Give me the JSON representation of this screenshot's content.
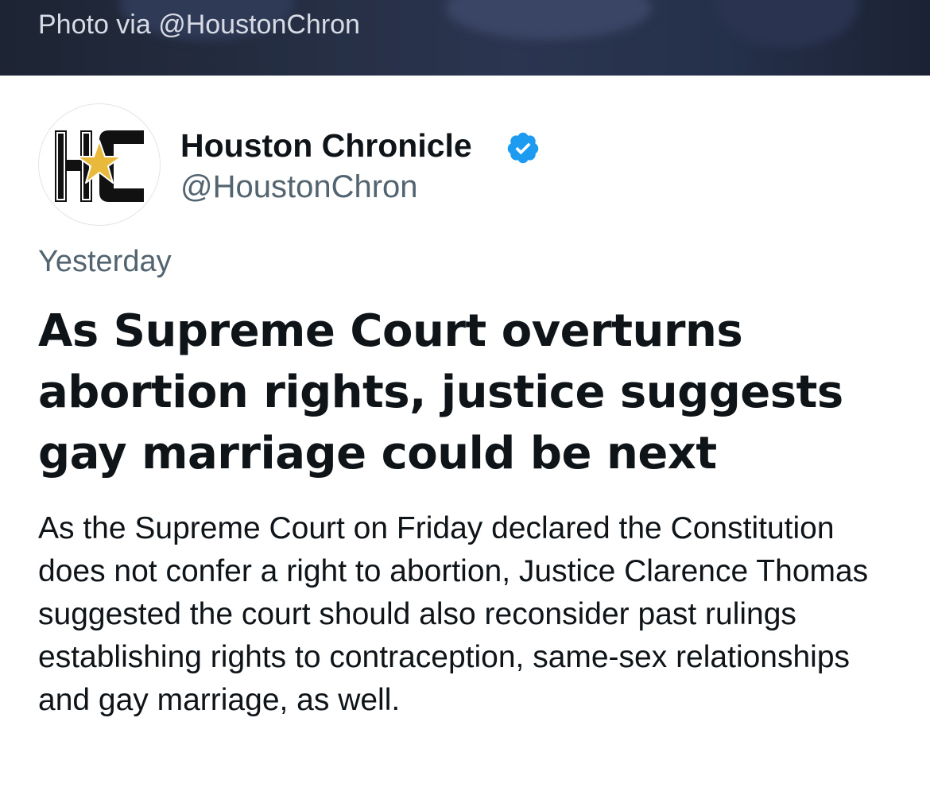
{
  "photo": {
    "credit": "Photo via @HoustonChron"
  },
  "author": {
    "name": "Houston Chronicle",
    "handle": "@HoustonChron",
    "verified": true,
    "verified_icon": "verified-badge-icon",
    "avatar_text": "HC"
  },
  "article": {
    "timestamp": "Yesterday",
    "headline": "As Supreme Court overturns abortion rights, justice suggests gay marriage could be next",
    "summary": "As the Supreme Court on Friday declared the Constitution does not confer a right to abortion, Justice Clarence Thomas suggested the court should also reconsider past rulings establishing rights to contraception, same-sex relationships and gay marriage, as well."
  },
  "colors": {
    "text_primary": "#0f1419",
    "text_secondary": "#536471",
    "verified_blue": "#1d9bf0",
    "star_gold": "#e8b93a",
    "banner_dark": "#232c3f"
  }
}
